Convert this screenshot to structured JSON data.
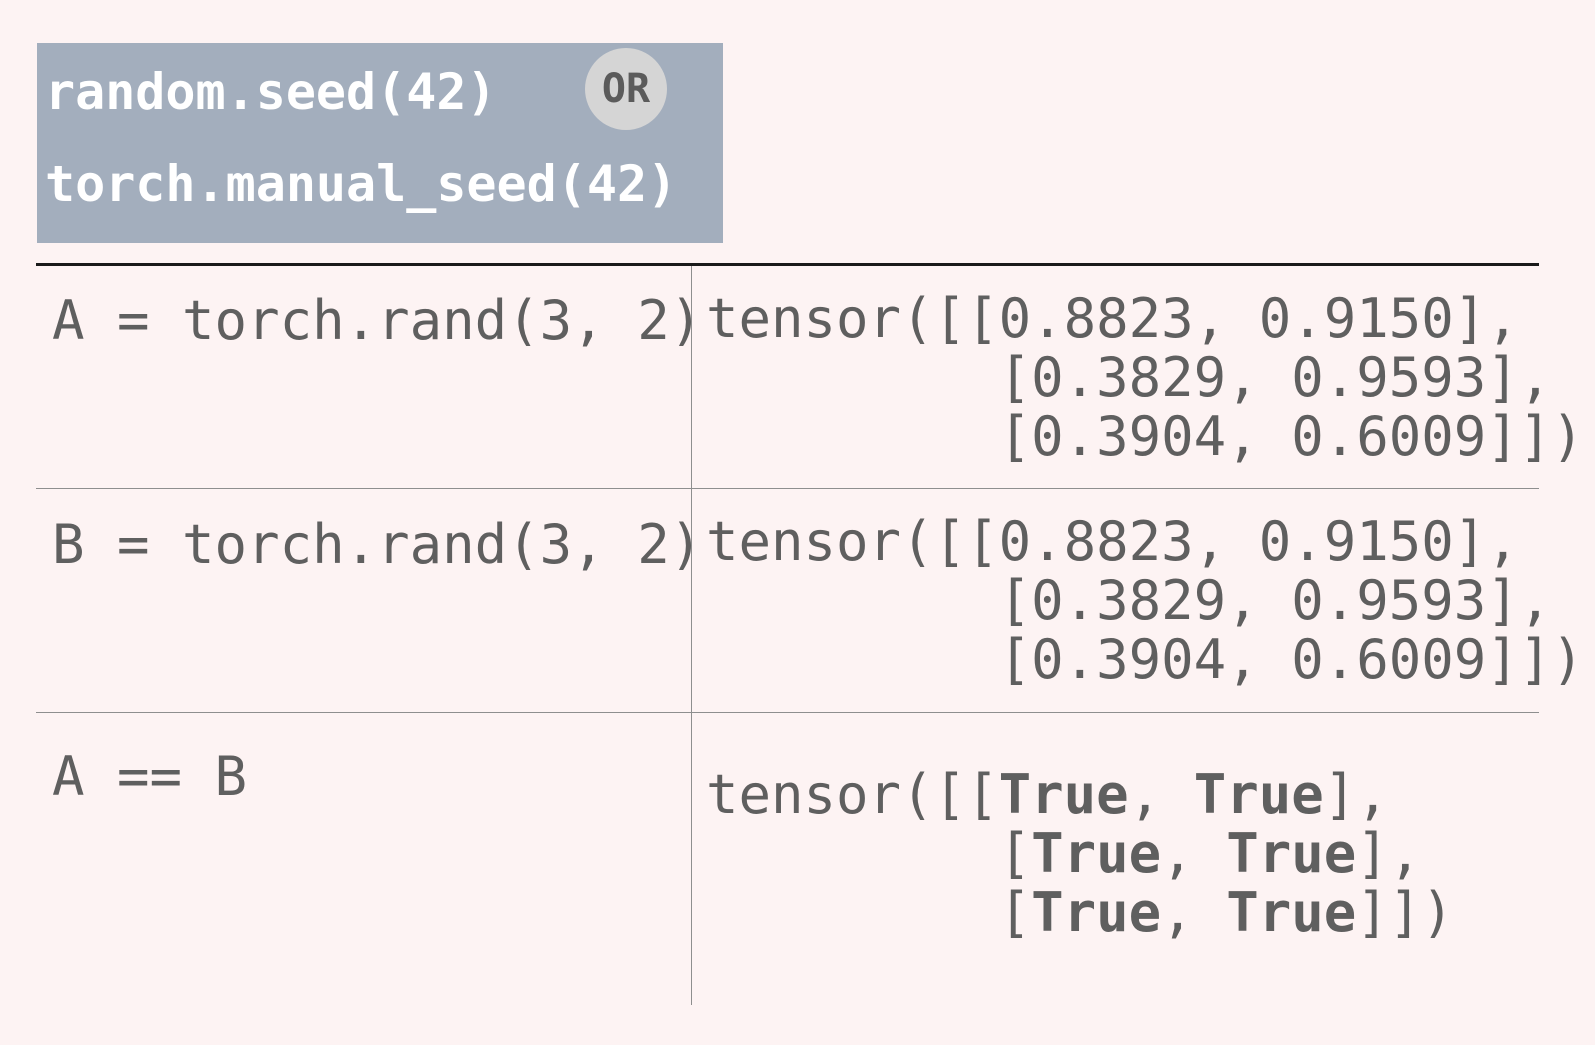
{
  "seed_box": {
    "line1": "random.seed(42)",
    "or_label": "OR",
    "line2": "torch.manual_seed(42)"
  },
  "rows": [
    {
      "code": "A = torch.rand(3, 2)",
      "output": {
        "prefix": "tensor([",
        "indent": "         ",
        "rows": [
          [
            "0.8823",
            "0.9150"
          ],
          [
            "0.3829",
            "0.9593"
          ],
          [
            "0.3904",
            "0.6009"
          ]
        ],
        "suffix": ")"
      }
    },
    {
      "code": "B = torch.rand(3, 2)",
      "output": {
        "prefix": "tensor([",
        "indent": "         ",
        "rows": [
          [
            "0.8823",
            "0.9150"
          ],
          [
            "0.3829",
            "0.9593"
          ],
          [
            "0.3904",
            "0.6009"
          ]
        ],
        "suffix": ")"
      }
    },
    {
      "code": "A == B",
      "output": {
        "prefix": "tensor([",
        "indent": "         ",
        "rows": [
          [
            "True",
            "True"
          ],
          [
            "True",
            "True"
          ],
          [
            "True",
            "True"
          ]
        ],
        "suffix": ")"
      }
    }
  ]
}
